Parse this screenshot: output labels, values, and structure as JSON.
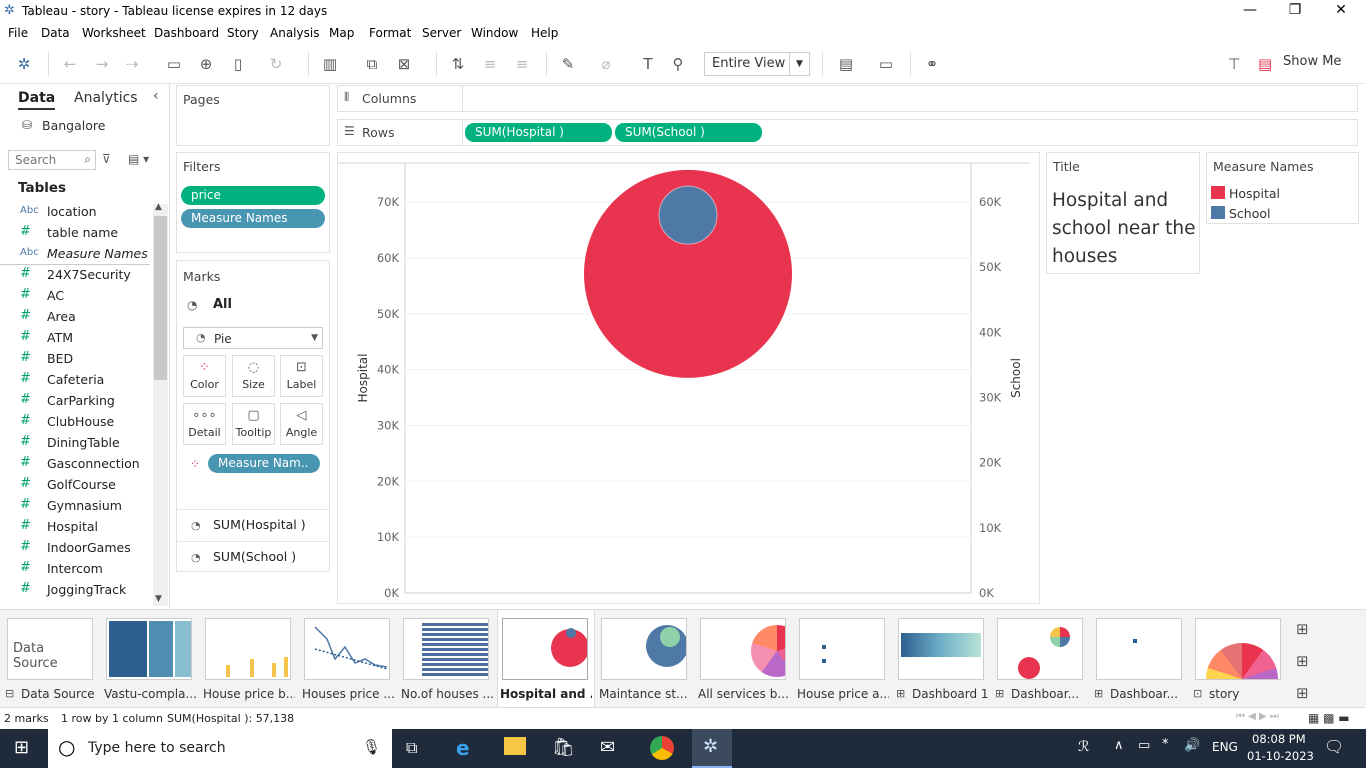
{
  "window": {
    "title": "Tableau - story - Tableau license expires in 12 days"
  },
  "menu": [
    "File",
    "Data",
    "Worksheet",
    "Dashboard",
    "Story",
    "Analysis",
    "Map",
    "Format",
    "Server",
    "Window",
    "Help"
  ],
  "toolbar": {
    "view_select": "Entire View",
    "show_me": "Show Me"
  },
  "datapane": {
    "tab_data": "Data",
    "tab_analytics": "Analytics",
    "datasource": "Bangalore",
    "search_placeholder": "Search",
    "tables_heading": "Tables",
    "fields": [
      {
        "type": "Abc",
        "name": "location"
      },
      {
        "type": "#",
        "name": "table name"
      },
      {
        "type": "Abc",
        "name": "Measure Names"
      },
      {
        "type": "#",
        "name": "24X7Security"
      },
      {
        "type": "#",
        "name": "AC"
      },
      {
        "type": "#",
        "name": "Area"
      },
      {
        "type": "#",
        "name": "ATM"
      },
      {
        "type": "#",
        "name": "BED"
      },
      {
        "type": "#",
        "name": "Cafeteria"
      },
      {
        "type": "#",
        "name": "CarParking"
      },
      {
        "type": "#",
        "name": "ClubHouse"
      },
      {
        "type": "#",
        "name": "DiningTable"
      },
      {
        "type": "#",
        "name": "Gasconnection"
      },
      {
        "type": "#",
        "name": "GolfCourse"
      },
      {
        "type": "#",
        "name": "Gymnasium"
      },
      {
        "type": "#",
        "name": "Hospital"
      },
      {
        "type": "#",
        "name": "IndoorGames"
      },
      {
        "type": "#",
        "name": "Intercom"
      },
      {
        "type": "#",
        "name": "JoggingTrack"
      }
    ]
  },
  "shelves": {
    "pages": "Pages",
    "filters": "Filters",
    "filter_pills": [
      "price",
      "Measure Names"
    ],
    "columns": "Columns",
    "rows": "Rows",
    "row_pills": [
      "SUM(Hospital )",
      "SUM(School )"
    ]
  },
  "marks": {
    "title": "Marks",
    "all": "All",
    "mark_type": "Pie",
    "buttons": [
      "Color",
      "Size",
      "Label",
      "Detail",
      "Tooltip",
      "Angle"
    ],
    "color_pill": "Measure Nam..",
    "sum_hospital": "SUM(Hospital )",
    "sum_school": "SUM(School )"
  },
  "title_card": {
    "heading": "Title",
    "text": "Hospital and school near the houses"
  },
  "legend": {
    "heading": "Measure Names",
    "items": [
      {
        "name": "Hospital",
        "color": "#e8344f"
      },
      {
        "name": "School",
        "color": "#4e79a7"
      }
    ]
  },
  "chart_data": {
    "type": "scatter",
    "title": "",
    "left_axis": {
      "label": "Hospital",
      "ticks": [
        "70K",
        "60K",
        "50K",
        "40K",
        "30K",
        "20K",
        "10K",
        "0K"
      ],
      "range": [
        0,
        77000
      ]
    },
    "right_axis": {
      "label": "School",
      "ticks": [
        "60K",
        "50K",
        "40K",
        "30K",
        "20K",
        "10K",
        "0K"
      ],
      "range": [
        0,
        66000
      ]
    },
    "series": [
      {
        "name": "Hospital",
        "value": 57138,
        "color": "#e8344f"
      },
      {
        "name": "School",
        "value": 58000,
        "color": "#4e79a7"
      }
    ]
  },
  "tabs": [
    {
      "label": "Data Source"
    },
    {
      "label": "Vastu-compla..."
    },
    {
      "label": "House price b..."
    },
    {
      "label": "Houses price ..."
    },
    {
      "label": "No.of houses ..."
    },
    {
      "label": "Hospital and ..."
    },
    {
      "label": "Maintance st..."
    },
    {
      "label": "All services b..."
    },
    {
      "label": "House price a..."
    },
    {
      "label": "Dashboard 1"
    },
    {
      "label": "Dashboar..."
    },
    {
      "label": "Dashboar..."
    },
    {
      "label": "story"
    }
  ],
  "datasource_thumb": "Data Source",
  "status": {
    "marks": "2 marks",
    "rows": "1 row by 1 column",
    "sum": "SUM(Hospital ): 57,138"
  },
  "taskbar": {
    "search_placeholder": "Type here to search",
    "lang": "ENG",
    "time": "08:08 PM",
    "date": "01-10-2023"
  }
}
